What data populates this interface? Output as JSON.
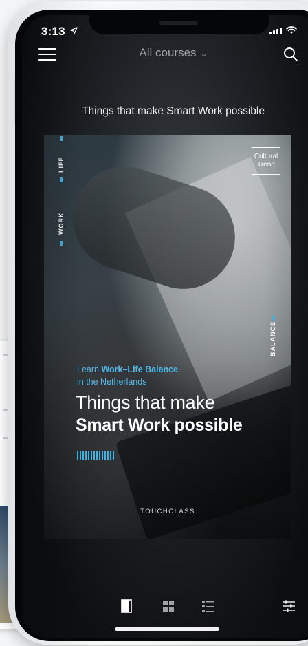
{
  "status": {
    "time": "3:13"
  },
  "nav": {
    "title": "All courses"
  },
  "course": {
    "heading": "Things that make Smart Work possible",
    "badge": [
      "Cultural",
      "Trend"
    ],
    "vertical_labels": {
      "life": "LIFE",
      "work": "WORK",
      "balance": "BALANCE"
    },
    "learn_prefix": "Learn ",
    "learn_bold": "Work–Life Balance",
    "learn_sub": "in the Netherlands",
    "title_line1": "Things that make",
    "title_line2": "Smart Work possible",
    "brand": "TOUCHCLASS"
  },
  "colors": {
    "accent": "#3fb3e6",
    "background": "#1d2024",
    "text": "#ffffff"
  },
  "toolbar": {
    "items": [
      "single-view-icon",
      "grid-view-icon",
      "list-view-icon",
      "filter-sliders-icon"
    ],
    "active": "single-view-icon"
  }
}
